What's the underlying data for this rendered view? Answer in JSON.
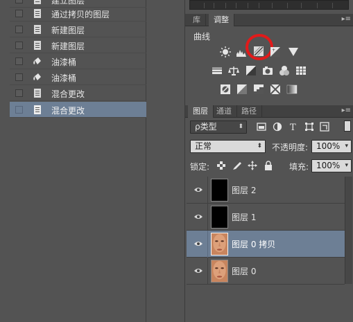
{
  "history": {
    "items": [
      {
        "label": "建立图层",
        "icon": "document-icon",
        "selected": false
      },
      {
        "label": "通过拷贝的图层",
        "icon": "document-icon",
        "selected": false
      },
      {
        "label": "新建图层",
        "icon": "document-icon",
        "selected": false
      },
      {
        "label": "新建图层",
        "icon": "document-icon",
        "selected": false
      },
      {
        "label": "油漆桶",
        "icon": "paint-bucket-icon",
        "selected": false
      },
      {
        "label": "油漆桶",
        "icon": "paint-bucket-icon",
        "selected": false
      },
      {
        "label": "混合更改",
        "icon": "document-icon",
        "selected": false
      },
      {
        "label": "混合更改",
        "icon": "document-icon",
        "selected": true
      }
    ]
  },
  "adjustments": {
    "tabs": [
      {
        "label": "库",
        "active": false
      },
      {
        "label": "调整",
        "active": true
      }
    ],
    "title": "曲线",
    "highlighted_icon": "curves-icon",
    "highlight_color": "#e21a1a"
  },
  "layers_panel": {
    "tabs": [
      {
        "label": "图层",
        "active": true
      },
      {
        "label": "通道",
        "active": false
      },
      {
        "label": "路径",
        "active": false
      }
    ],
    "filter_kind": "ρ类型",
    "blend_mode": "正常",
    "opacity_label": "不透明度:",
    "opacity_value": "100%",
    "lock_label": "锁定:",
    "fill_label": "填充:",
    "fill_value": "100%",
    "layers": [
      {
        "name": "图层 2",
        "thumb": "black",
        "visible": true,
        "selected": false
      },
      {
        "name": "图层 1",
        "thumb": "black",
        "visible": true,
        "selected": false
      },
      {
        "name": "图层 0 拷贝",
        "thumb": "face",
        "visible": true,
        "selected": true
      },
      {
        "name": "图层 0",
        "thumb": "face",
        "visible": true,
        "selected": false
      }
    ]
  },
  "colors": {
    "panel_bg": "#535353",
    "selection": "#6d7f95",
    "accent_red": "#e21a1a"
  }
}
